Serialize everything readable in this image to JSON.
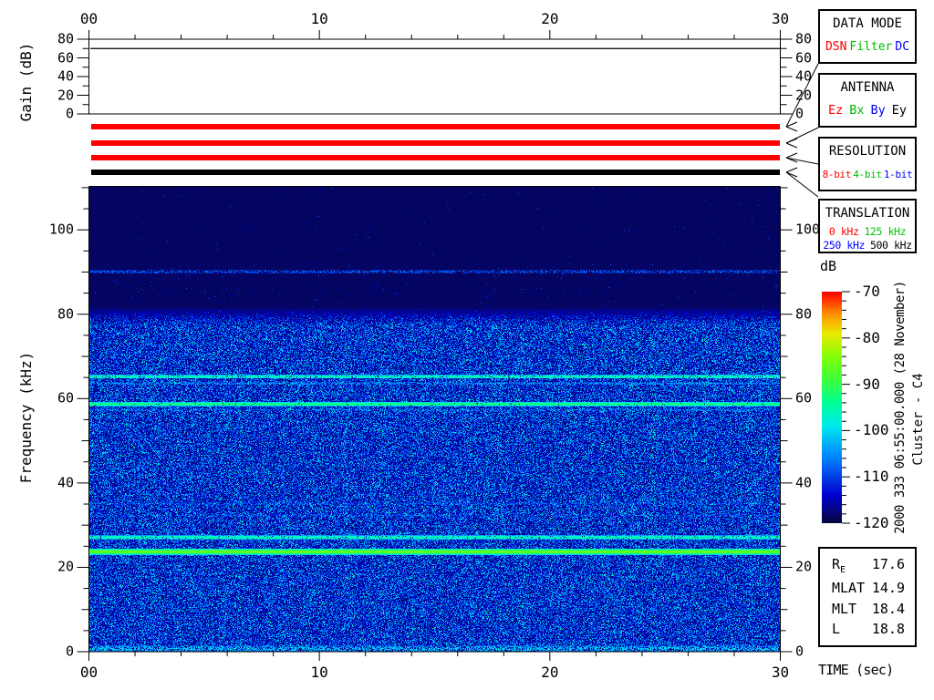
{
  "window": {
    "background": "#ffffff"
  },
  "gain_panel": {
    "ylabel": "Gain (dB)",
    "ytick_labels": [
      "0",
      "20",
      "40",
      "60",
      "80"
    ],
    "gain_db": 70
  },
  "time_axis": {
    "tick_labels": [
      "00",
      "10",
      "20",
      "30"
    ],
    "label": "TIME (sec)"
  },
  "spectrogram_panel": {
    "ylabel": "Frequency (kHz)",
    "ytick_labels": [
      "0",
      "20",
      "40",
      "60",
      "80",
      "100"
    ]
  },
  "colorbar": {
    "label": "dB",
    "tick_labels": [
      "-70",
      "-80",
      "-90",
      "-100",
      "-110",
      "-120"
    ]
  },
  "status_bars": [
    {
      "name": "data-mode",
      "selected": "DSN",
      "color": "#ff0000"
    },
    {
      "name": "antenna",
      "selected": "Ez",
      "color": "#ff0000"
    },
    {
      "name": "resolution",
      "selected": "8-bit",
      "color": "#ff0000"
    },
    {
      "name": "translation",
      "selected": "500 kHz",
      "color": "#000000"
    }
  ],
  "legend_boxes": [
    {
      "title": "DATA MODE",
      "lines": [
        [
          {
            "label": "DSN",
            "color": "#ff0000"
          },
          {
            "label": "Filter",
            "color": "#00bb00"
          },
          {
            "label": "DC",
            "color": "#0000ff"
          }
        ]
      ]
    },
    {
      "title": "ANTENNA",
      "lines": [
        [
          {
            "label": "Ez",
            "color": "#ff0000"
          },
          {
            "label": "Bx",
            "color": "#00bb00"
          },
          {
            "label": "By",
            "color": "#0000ff"
          },
          {
            "label": "Ey",
            "color": "#000000"
          }
        ]
      ]
    },
    {
      "title": "RESOLUTION",
      "lines": [
        [
          {
            "label": "8-bit",
            "color": "#ff0000"
          },
          {
            "label": "4-bit",
            "color": "#00bb00"
          },
          {
            "label": "1-bit",
            "color": "#0000ff"
          }
        ]
      ]
    },
    {
      "title": "TRANSLATION",
      "lines": [
        [
          {
            "label": "0 kHz",
            "color": "#ff0000"
          },
          {
            "label": "125 kHz",
            "color": "#00c800"
          }
        ],
        [
          {
            "label": "250 kHz",
            "color": "#0000ff"
          },
          {
            "label": "500 kHz",
            "color": "#000000"
          }
        ]
      ]
    }
  ],
  "annotations": {
    "datetime": "2000 333 06:55:00.000 (28 November)",
    "spacecraft": "Cluster - C4"
  },
  "ephemeris": {
    "rows": [
      {
        "label": "R",
        "sub": "E",
        "value": "17.6"
      },
      {
        "label": "MLAT",
        "value": "14.9"
      },
      {
        "label": "MLT",
        "value": "18.4"
      },
      {
        "label": "L",
        "value": "18.8"
      }
    ]
  },
  "chart_data": [
    {
      "type": "line",
      "name": "receiver_gain",
      "title": "Receiver gain vs time",
      "x": [
        0,
        30
      ],
      "y": [
        70,
        70
      ],
      "xlabel": "TIME (sec)",
      "ylabel": "Gain (dB)",
      "xlim": [
        0,
        30
      ],
      "ylim": [
        0,
        80
      ],
      "ticks": {
        "x_major": 10,
        "x_minor": 2,
        "y_major": 20,
        "y_minor": 10
      },
      "grid": false,
      "legend": false
    },
    {
      "type": "heatmap",
      "name": "wbd_spectrogram",
      "xlabel": "TIME (sec)",
      "ylabel": "Frequency (kHz)",
      "zlabel": "dB",
      "xlim": [
        0,
        30
      ],
      "ylim": [
        0,
        110.2
      ],
      "zlim": [
        -120,
        -70
      ],
      "colorbar_side": "right",
      "colormap_stops": [
        [
          0,
          "#060640"
        ],
        [
          0.12,
          "#0000d2"
        ],
        [
          0.3,
          "#0090ff"
        ],
        [
          0.42,
          "#00ebeb"
        ],
        [
          0.52,
          "#00ff96"
        ],
        [
          0.62,
          "#3cff3c"
        ],
        [
          0.72,
          "#82ff0a"
        ],
        [
          0.82,
          "#ebeb00"
        ],
        [
          0.9,
          "#ff9600"
        ],
        [
          1,
          "#ff0000"
        ]
      ],
      "background_db": -119,
      "noise_floor": {
        "freq_max_khz": 81.5,
        "transition_khz": 4,
        "db_range": [
          -117,
          -99
        ],
        "speckle_fraction": 0.05,
        "seed": 20001128
      },
      "spectral_lines": [
        {
          "freq_khz": 90.2,
          "db": -108,
          "width_khz": 0.9,
          "duty": 0.55
        },
        {
          "freq_khz": 65.3,
          "db": -95,
          "width_khz": 0.9,
          "duty": 0.9
        },
        {
          "freq_khz": 63.7,
          "db": -105,
          "width_khz": 0.7,
          "duty": 0.6
        },
        {
          "freq_khz": 58.8,
          "db": -92,
          "width_khz": 1.0,
          "duty": 0.95
        },
        {
          "freq_khz": 57.4,
          "db": -106,
          "width_khz": 0.6,
          "duty": 0.5
        },
        {
          "freq_khz": 35.2,
          "db": -109,
          "width_khz": 0.6,
          "duty": 0.5
        },
        {
          "freq_khz": 32.4,
          "db": -110,
          "width_khz": 0.6,
          "duty": 0.45
        },
        {
          "freq_khz": 27.2,
          "db": -95,
          "width_khz": 1.0,
          "duty": 0.9
        },
        {
          "freq_khz": 23.8,
          "db": -86,
          "width_khz": 1.4,
          "duty": 1.0
        },
        {
          "freq_khz": 0.8,
          "db": -101,
          "width_khz": 1.6,
          "duty": 0.5
        }
      ]
    }
  ]
}
